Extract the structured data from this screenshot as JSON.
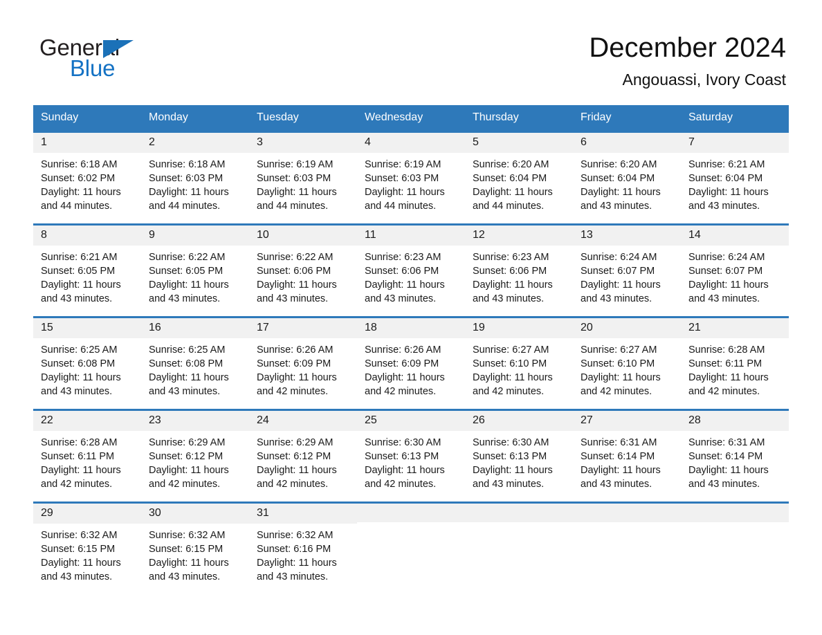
{
  "brand": {
    "name_part1": "General",
    "name_part2": "Blue",
    "triangle_color": "#1b71b8",
    "blue_color": "#1472c4"
  },
  "header": {
    "month_title": "December 2024",
    "location": "Angouassi, Ivory Coast"
  },
  "theme": {
    "header_bg": "#2e79ba",
    "header_text": "#ffffff",
    "daynum_bg": "#f1f1f1",
    "row_border": "#2e79ba",
    "page_bg": "#ffffff"
  },
  "calendar": {
    "weekday_headers": [
      "Sunday",
      "Monday",
      "Tuesday",
      "Wednesday",
      "Thursday",
      "Friday",
      "Saturday"
    ],
    "weeks": [
      [
        {
          "day": "1",
          "sunrise": "Sunrise: 6:18 AM",
          "sunset": "Sunset: 6:02 PM",
          "daylight_line1": "Daylight: 11 hours",
          "daylight_line2": "and 44 minutes."
        },
        {
          "day": "2",
          "sunrise": "Sunrise: 6:18 AM",
          "sunset": "Sunset: 6:03 PM",
          "daylight_line1": "Daylight: 11 hours",
          "daylight_line2": "and 44 minutes."
        },
        {
          "day": "3",
          "sunrise": "Sunrise: 6:19 AM",
          "sunset": "Sunset: 6:03 PM",
          "daylight_line1": "Daylight: 11 hours",
          "daylight_line2": "and 44 minutes."
        },
        {
          "day": "4",
          "sunrise": "Sunrise: 6:19 AM",
          "sunset": "Sunset: 6:03 PM",
          "daylight_line1": "Daylight: 11 hours",
          "daylight_line2": "and 44 minutes."
        },
        {
          "day": "5",
          "sunrise": "Sunrise: 6:20 AM",
          "sunset": "Sunset: 6:04 PM",
          "daylight_line1": "Daylight: 11 hours",
          "daylight_line2": "and 44 minutes."
        },
        {
          "day": "6",
          "sunrise": "Sunrise: 6:20 AM",
          "sunset": "Sunset: 6:04 PM",
          "daylight_line1": "Daylight: 11 hours",
          "daylight_line2": "and 43 minutes."
        },
        {
          "day": "7",
          "sunrise": "Sunrise: 6:21 AM",
          "sunset": "Sunset: 6:04 PM",
          "daylight_line1": "Daylight: 11 hours",
          "daylight_line2": "and 43 minutes."
        }
      ],
      [
        {
          "day": "8",
          "sunrise": "Sunrise: 6:21 AM",
          "sunset": "Sunset: 6:05 PM",
          "daylight_line1": "Daylight: 11 hours",
          "daylight_line2": "and 43 minutes."
        },
        {
          "day": "9",
          "sunrise": "Sunrise: 6:22 AM",
          "sunset": "Sunset: 6:05 PM",
          "daylight_line1": "Daylight: 11 hours",
          "daylight_line2": "and 43 minutes."
        },
        {
          "day": "10",
          "sunrise": "Sunrise: 6:22 AM",
          "sunset": "Sunset: 6:06 PM",
          "daylight_line1": "Daylight: 11 hours",
          "daylight_line2": "and 43 minutes."
        },
        {
          "day": "11",
          "sunrise": "Sunrise: 6:23 AM",
          "sunset": "Sunset: 6:06 PM",
          "daylight_line1": "Daylight: 11 hours",
          "daylight_line2": "and 43 minutes."
        },
        {
          "day": "12",
          "sunrise": "Sunrise: 6:23 AM",
          "sunset": "Sunset: 6:06 PM",
          "daylight_line1": "Daylight: 11 hours",
          "daylight_line2": "and 43 minutes."
        },
        {
          "day": "13",
          "sunrise": "Sunrise: 6:24 AM",
          "sunset": "Sunset: 6:07 PM",
          "daylight_line1": "Daylight: 11 hours",
          "daylight_line2": "and 43 minutes."
        },
        {
          "day": "14",
          "sunrise": "Sunrise: 6:24 AM",
          "sunset": "Sunset: 6:07 PM",
          "daylight_line1": "Daylight: 11 hours",
          "daylight_line2": "and 43 minutes."
        }
      ],
      [
        {
          "day": "15",
          "sunrise": "Sunrise: 6:25 AM",
          "sunset": "Sunset: 6:08 PM",
          "daylight_line1": "Daylight: 11 hours",
          "daylight_line2": "and 43 minutes."
        },
        {
          "day": "16",
          "sunrise": "Sunrise: 6:25 AM",
          "sunset": "Sunset: 6:08 PM",
          "daylight_line1": "Daylight: 11 hours",
          "daylight_line2": "and 43 minutes."
        },
        {
          "day": "17",
          "sunrise": "Sunrise: 6:26 AM",
          "sunset": "Sunset: 6:09 PM",
          "daylight_line1": "Daylight: 11 hours",
          "daylight_line2": "and 42 minutes."
        },
        {
          "day": "18",
          "sunrise": "Sunrise: 6:26 AM",
          "sunset": "Sunset: 6:09 PM",
          "daylight_line1": "Daylight: 11 hours",
          "daylight_line2": "and 42 minutes."
        },
        {
          "day": "19",
          "sunrise": "Sunrise: 6:27 AM",
          "sunset": "Sunset: 6:10 PM",
          "daylight_line1": "Daylight: 11 hours",
          "daylight_line2": "and 42 minutes."
        },
        {
          "day": "20",
          "sunrise": "Sunrise: 6:27 AM",
          "sunset": "Sunset: 6:10 PM",
          "daylight_line1": "Daylight: 11 hours",
          "daylight_line2": "and 42 minutes."
        },
        {
          "day": "21",
          "sunrise": "Sunrise: 6:28 AM",
          "sunset": "Sunset: 6:11 PM",
          "daylight_line1": "Daylight: 11 hours",
          "daylight_line2": "and 42 minutes."
        }
      ],
      [
        {
          "day": "22",
          "sunrise": "Sunrise: 6:28 AM",
          "sunset": "Sunset: 6:11 PM",
          "daylight_line1": "Daylight: 11 hours",
          "daylight_line2": "and 42 minutes."
        },
        {
          "day": "23",
          "sunrise": "Sunrise: 6:29 AM",
          "sunset": "Sunset: 6:12 PM",
          "daylight_line1": "Daylight: 11 hours",
          "daylight_line2": "and 42 minutes."
        },
        {
          "day": "24",
          "sunrise": "Sunrise: 6:29 AM",
          "sunset": "Sunset: 6:12 PM",
          "daylight_line1": "Daylight: 11 hours",
          "daylight_line2": "and 42 minutes."
        },
        {
          "day": "25",
          "sunrise": "Sunrise: 6:30 AM",
          "sunset": "Sunset: 6:13 PM",
          "daylight_line1": "Daylight: 11 hours",
          "daylight_line2": "and 42 minutes."
        },
        {
          "day": "26",
          "sunrise": "Sunrise: 6:30 AM",
          "sunset": "Sunset: 6:13 PM",
          "daylight_line1": "Daylight: 11 hours",
          "daylight_line2": "and 43 minutes."
        },
        {
          "day": "27",
          "sunrise": "Sunrise: 6:31 AM",
          "sunset": "Sunset: 6:14 PM",
          "daylight_line1": "Daylight: 11 hours",
          "daylight_line2": "and 43 minutes."
        },
        {
          "day": "28",
          "sunrise": "Sunrise: 6:31 AM",
          "sunset": "Sunset: 6:14 PM",
          "daylight_line1": "Daylight: 11 hours",
          "daylight_line2": "and 43 minutes."
        }
      ],
      [
        {
          "day": "29",
          "sunrise": "Sunrise: 6:32 AM",
          "sunset": "Sunset: 6:15 PM",
          "daylight_line1": "Daylight: 11 hours",
          "daylight_line2": "and 43 minutes."
        },
        {
          "day": "30",
          "sunrise": "Sunrise: 6:32 AM",
          "sunset": "Sunset: 6:15 PM",
          "daylight_line1": "Daylight: 11 hours",
          "daylight_line2": "and 43 minutes."
        },
        {
          "day": "31",
          "sunrise": "Sunrise: 6:32 AM",
          "sunset": "Sunset: 6:16 PM",
          "daylight_line1": "Daylight: 11 hours",
          "daylight_line2": "and 43 minutes."
        },
        {
          "day": "",
          "sunrise": "",
          "sunset": "",
          "daylight_line1": "",
          "daylight_line2": ""
        },
        {
          "day": "",
          "sunrise": "",
          "sunset": "",
          "daylight_line1": "",
          "daylight_line2": ""
        },
        {
          "day": "",
          "sunrise": "",
          "sunset": "",
          "daylight_line1": "",
          "daylight_line2": ""
        },
        {
          "day": "",
          "sunrise": "",
          "sunset": "",
          "daylight_line1": "",
          "daylight_line2": ""
        }
      ]
    ]
  }
}
